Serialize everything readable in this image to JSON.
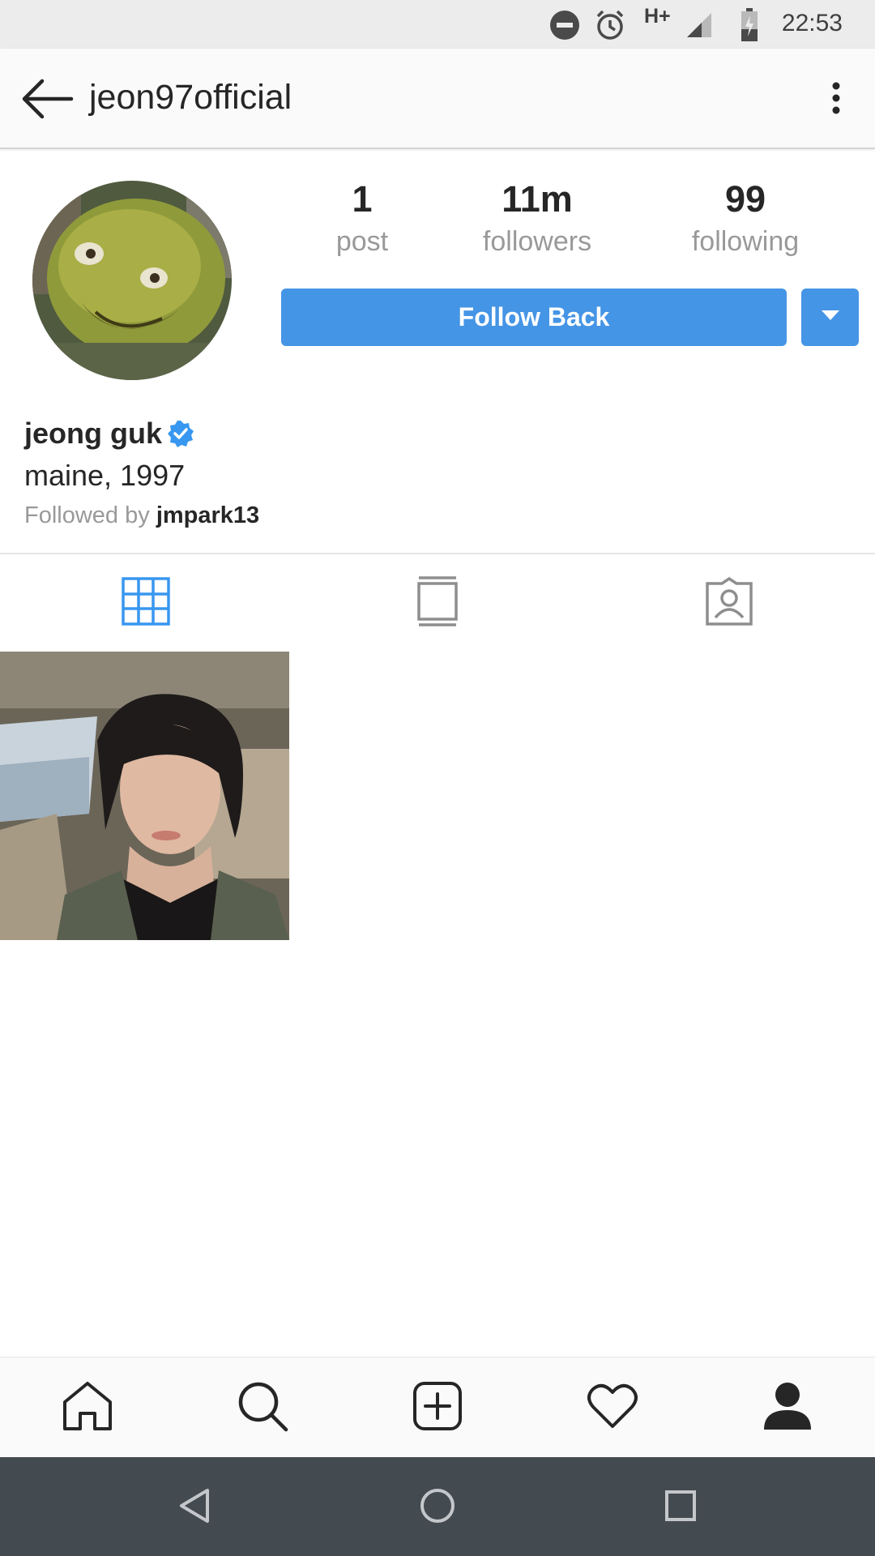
{
  "status_bar": {
    "time": "22:53",
    "network": "H+",
    "icons": [
      "do-not-disturb-icon",
      "alarm-icon",
      "signal-icon",
      "battery-charging-icon"
    ]
  },
  "header": {
    "username": "jeon97official",
    "icons": [
      "back-arrow-icon",
      "more-vertical-icon"
    ]
  },
  "profile": {
    "stats": [
      {
        "value": "1",
        "label": "post"
      },
      {
        "value": "11m",
        "label": "followers"
      },
      {
        "value": "99",
        "label": "following"
      }
    ],
    "follow_button": "Follow Back",
    "full_name": "jeong guk",
    "bio": "maine, 1997",
    "followed_by_prefix": "Followed by",
    "followed_by_user": "jmpark13"
  },
  "tabs": [
    "grid-icon",
    "feed-icon",
    "tagged-icon"
  ],
  "bottom_nav": [
    "home-icon",
    "search-icon",
    "add-post-icon",
    "heart-icon",
    "profile-icon"
  ],
  "system_nav": [
    "back-triangle-icon",
    "home-circle-icon",
    "recents-square-icon"
  ],
  "colors": {
    "accent": "#4595e6",
    "text": "#262626",
    "muted": "#999999",
    "system_nav_bg": "#434a50"
  }
}
